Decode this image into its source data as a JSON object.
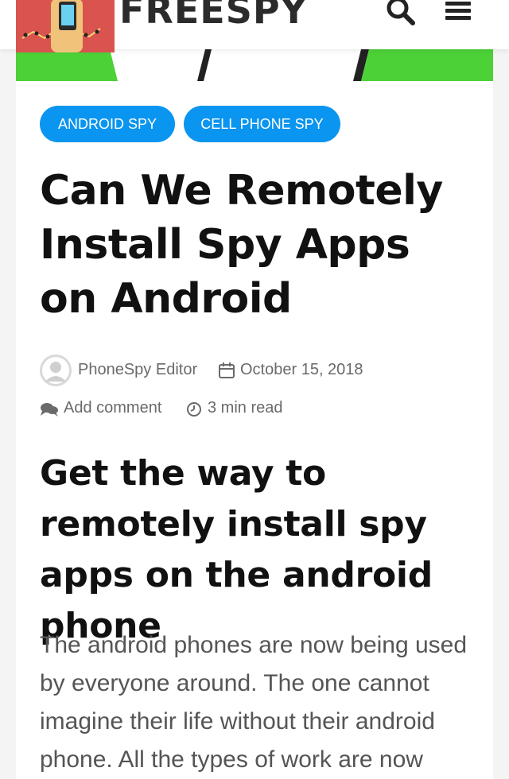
{
  "header": {
    "logo_text": "FREESPY",
    "logo_alt": "FreeSpy logo"
  },
  "tags": [
    {
      "label": "ANDROID SPY"
    },
    {
      "label": "CELL PHONE SPY"
    }
  ],
  "article": {
    "title": "Can We Remotely Install Spy Apps on Android",
    "author": "PhoneSpy Editor",
    "date": "October 15, 2018",
    "comment_link": "Add comment",
    "read_time": "3 min read",
    "subheading": "Get the way to remotely install spy apps on the android phone",
    "body": "The android phones are now being used by everyone around. The one cannot imagine their life without their android phone. All the types of work are now"
  },
  "colors": {
    "tag_bg": "#0a95f0",
    "hero_green": "#4cd137",
    "logo_bg": "#d9534f"
  },
  "icons": [
    "search-icon",
    "menu-icon",
    "avatar-icon",
    "calendar-icon",
    "comment-icon",
    "clock-icon"
  ]
}
